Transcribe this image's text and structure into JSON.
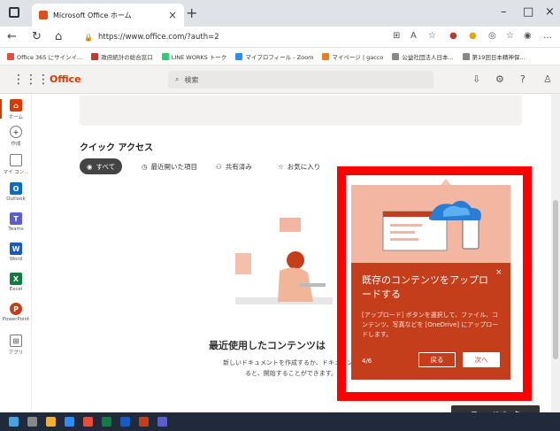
{
  "browser": {
    "tab_title": "Microsoft Office ホーム",
    "url": "https://www.office.com/?auth=2",
    "favorites": [
      {
        "label": "Office 365 にサインイ...",
        "color": "#e74c3c"
      },
      {
        "label": "政府統計の総合窓口",
        "color": "#c0392b"
      },
      {
        "label": "LINE WORKS トーク",
        "color": "#2ecc71"
      },
      {
        "label": "マイプロフィール - Zoom",
        "color": "#2d8cff"
      },
      {
        "label": "マイページ | gacco",
        "color": "#e67e22"
      },
      {
        "label": "公益社団法人日本...",
        "color": "#888888"
      },
      {
        "label": "第19回日本精神保...",
        "color": "#888888"
      }
    ]
  },
  "office": {
    "title": "Office",
    "search_placeholder": "検索"
  },
  "rail": [
    {
      "label": "ホーム",
      "icon": "home-icon",
      "color": "#d83b01"
    },
    {
      "label": "作成",
      "icon": "add-icon",
      "color": "#777777"
    },
    {
      "label": "マイ コン...",
      "icon": "folder-icon",
      "color": "#777777"
    },
    {
      "label": "Outlook",
      "icon": "outlook-icon",
      "color": "#0f6cbd"
    },
    {
      "label": "Teams",
      "icon": "teams-icon",
      "color": "#5b5fc7"
    },
    {
      "label": "Word",
      "icon": "word-icon",
      "color": "#185abd"
    },
    {
      "label": "Excel",
      "icon": "excel-icon",
      "color": "#107c41"
    },
    {
      "label": "PowerPoint",
      "icon": "powerpoint-icon",
      "color": "#c43e1c"
    },
    {
      "label": "アプリ",
      "icon": "apps-icon",
      "color": "#777777"
    }
  ],
  "quick_access": {
    "title": "クイック アクセス",
    "filters": [
      "すべて",
      "最近開いた項目",
      "共有済み",
      "お気に入り"
    ]
  },
  "empty_state": {
    "title": "最近使用したコンテンツは",
    "subtitle": "新しいドキュメントを作成するか、ドキュメント",
    "subtitle2": "ると、開始することができます。"
  },
  "popup": {
    "title": "既存のコンテンツをアップロードする",
    "body": "[アップロード] ボタンを選択して、ファイル、コンテンツ、写真などを [OneDrive] にアップロードします。",
    "page": "4/6",
    "back_label": "戻る",
    "next_label": "次へ"
  },
  "feedback_label": "フィードバック"
}
